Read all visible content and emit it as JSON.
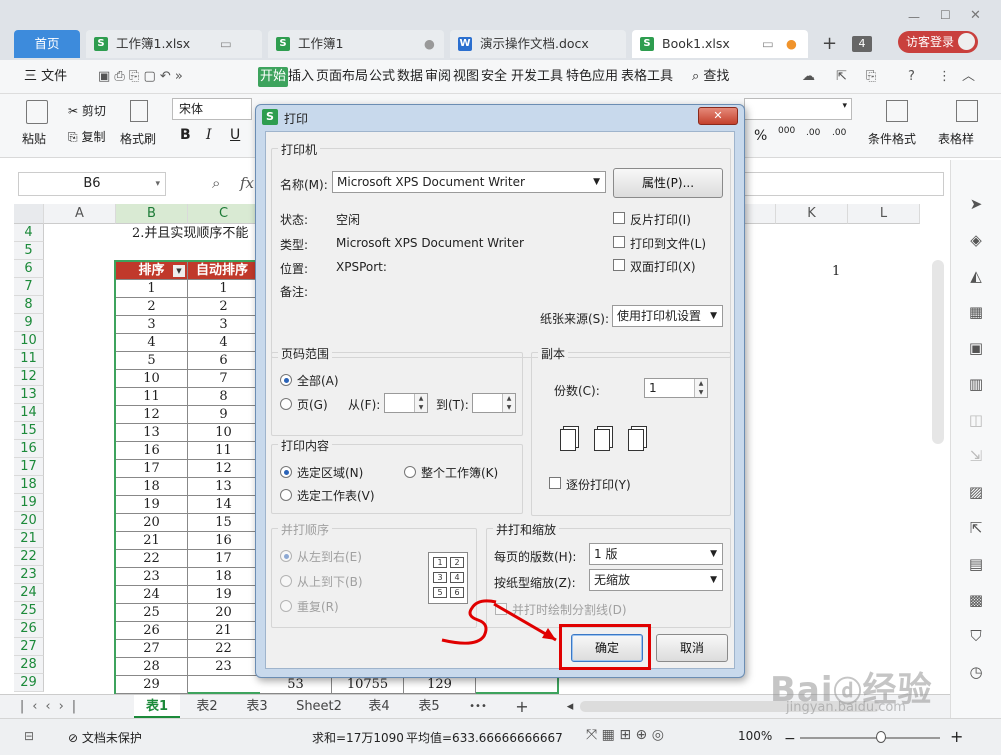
{
  "titlebar": {
    "tabs": [
      {
        "label": "首页"
      },
      {
        "label": "工作簿1.xlsx"
      },
      {
        "label": "工作簿1"
      },
      {
        "label": "演示操作文档.docx"
      },
      {
        "label": "Book1.xlsx"
      }
    ],
    "tab_count": "4",
    "visitor_login": "访客登录"
  },
  "menu": {
    "file": "三 文件",
    "items": [
      "开始",
      "插入",
      "页面布局",
      "公式",
      "数据",
      "审阅",
      "视图",
      "安全",
      "开发工具",
      "特色应用",
      "表格工具"
    ],
    "search": "查找"
  },
  "ribbon": {
    "paste": "粘贴",
    "cut": "剪切",
    "copy": "复制",
    "format_painter": "格式刷",
    "font": "宋体",
    "bold": "B",
    "italic": "I",
    "underline": "U",
    "percent": "%",
    "thousands": "000",
    "dec_inc": ".00",
    "dec_dec": ".00",
    "cond_format": "条件格式",
    "table_style": "表格样"
  },
  "formula_bar": {
    "cell_ref": "B6",
    "fx": "fx"
  },
  "sheet": {
    "columns": [
      "A",
      "B",
      "C",
      "K",
      "L"
    ],
    "row_numbers": [
      "4",
      "5",
      "6",
      "7",
      "8",
      "9",
      "10",
      "11",
      "12",
      "13",
      "14",
      "15",
      "16",
      "17",
      "18",
      "19",
      "20",
      "21",
      "22",
      "23",
      "24",
      "25",
      "26",
      "27",
      "28",
      "29"
    ],
    "row4_text": "2.并且实现顺序不能",
    "header_b": "排序",
    "header_c": "自动排序",
    "col_b": [
      "1",
      "2",
      "3",
      "4",
      "5",
      "10",
      "11",
      "12",
      "13",
      "16",
      "17",
      "18",
      "19",
      "20",
      "21",
      "22",
      "23",
      "24",
      "25",
      "26",
      "27",
      "28",
      "29"
    ],
    "col_c": [
      "1",
      "2",
      "3",
      "4",
      "6",
      "7",
      "8",
      "9",
      "10",
      "11",
      "12",
      "13",
      "14",
      "15",
      "16",
      "17",
      "18",
      "19",
      "20",
      "21",
      "22",
      "23"
    ],
    "row29_d": "53",
    "row29_e": "10755",
    "row29_f": "129",
    "k6_value": "1"
  },
  "sheet_tabs": [
    "表1",
    "表2",
    "表3",
    "Sheet2",
    "表4",
    "表5"
  ],
  "status": {
    "protect": "文档未保护",
    "sum": "求和=17万1090",
    "avg": "平均值=633.66666666667",
    "zoom": "100%"
  },
  "dialog": {
    "title": "打印",
    "printer_group": "打印机",
    "name_label": "名称(M):",
    "printer_name": "Microsoft XPS Document Writer",
    "properties": "属性(P)...",
    "status_label": "状态:",
    "status_value": "空闲",
    "type_label": "类型:",
    "type_value": "Microsoft XPS Document Writer",
    "location_label": "位置:",
    "location_value": "XPSPort:",
    "comment_label": "备注:",
    "reverse_print": "反片打印(I)",
    "print_to_file": "打印到文件(L)",
    "duplex": "双面打印(X)",
    "paper_source_label": "纸张来源(S):",
    "paper_source": "使用打印机设置",
    "range_group": "页码范围",
    "all": "全部(A)",
    "pages": "页(G)",
    "from": "从(F):",
    "to": "到(T):",
    "copies_group": "副本",
    "copies_label": "份数(C):",
    "copies_value": "1",
    "collate": "逐份打印(Y)",
    "content_group": "打印内容",
    "selection": "选定区域(N)",
    "whole_workbook": "整个工作簿(K)",
    "selected_sheets": "选定工作表(V)",
    "order_group": "并打顺序",
    "left_to_right": "从左到右(E)",
    "top_to_bottom": "从上到下(B)",
    "repeat": "重复(R)",
    "zoom_group": "并打和缩放",
    "pages_per_sheet_label": "每页的版数(H):",
    "pages_per_sheet": "1 版",
    "scale_label": "按纸型缩放(Z):",
    "scale": "无缩放",
    "draw_lines": "并打时绘制分割线(D)",
    "ok": "确定",
    "cancel": "取消"
  },
  "colors": {
    "accent": "#3d8bdc",
    "header_fill": "#c0392b",
    "highlight": "#e00000",
    "selection": "#3da35d"
  }
}
